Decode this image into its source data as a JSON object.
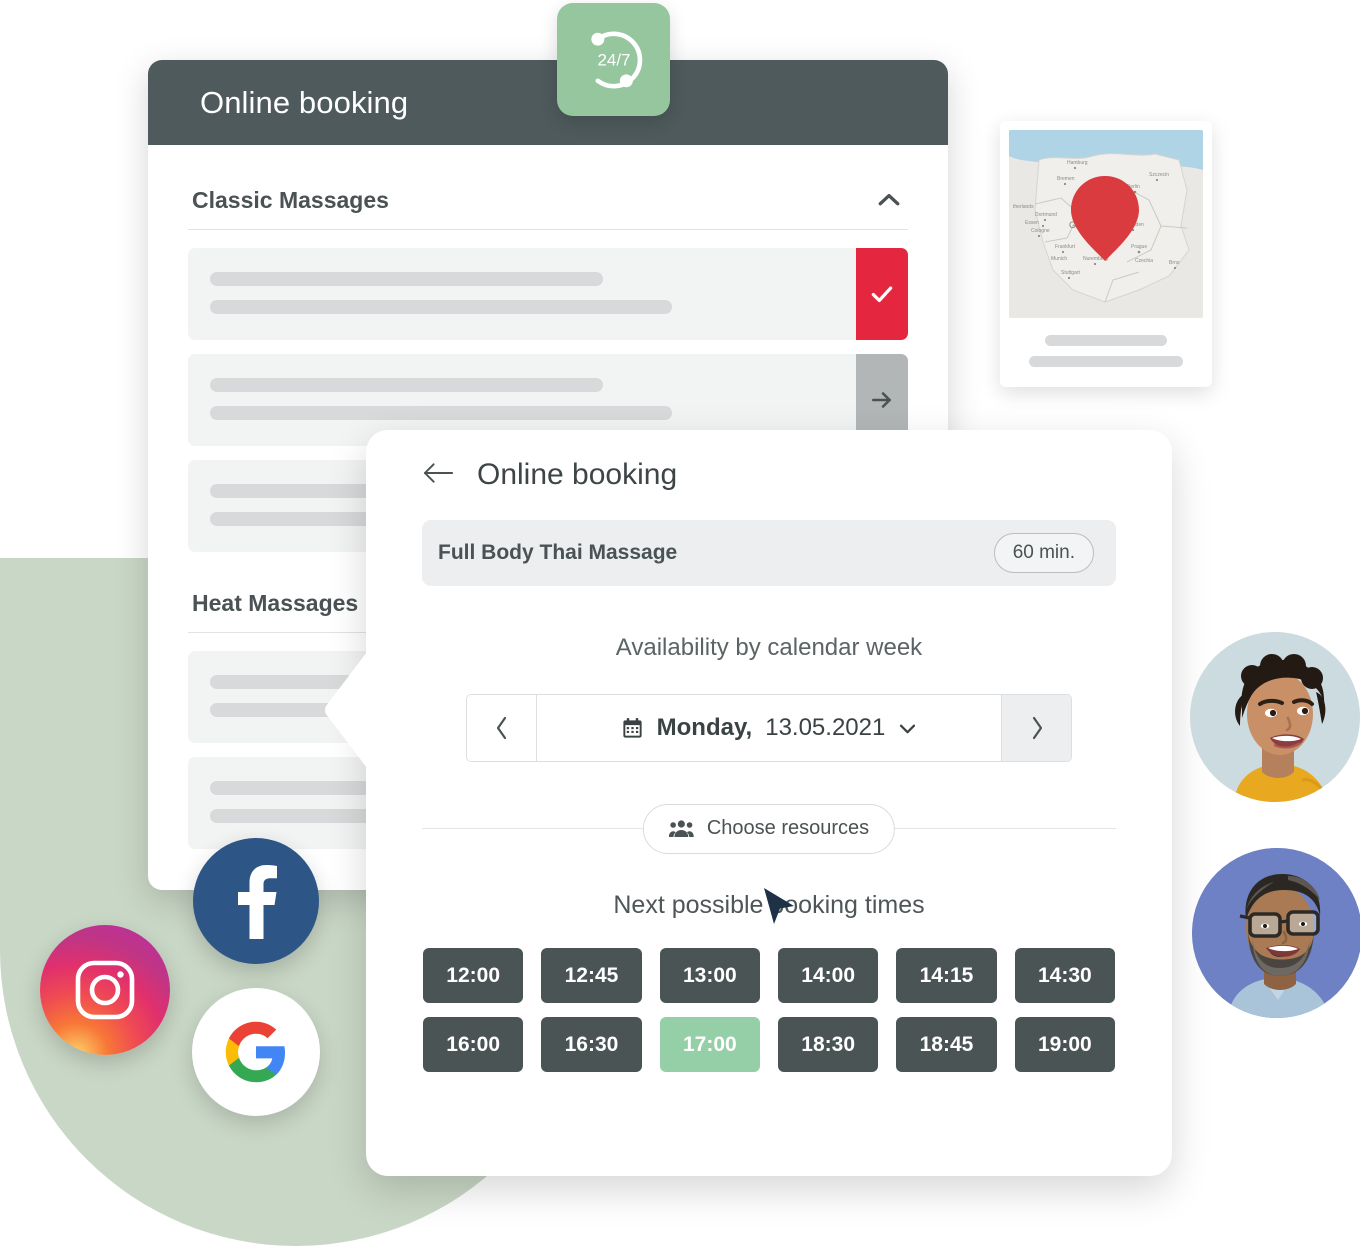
{
  "back_card": {
    "header_title": "Online booking",
    "badge": {
      "label": "24/7",
      "icon": "clock-cycle-icon",
      "color": "#95c69e"
    },
    "sections": [
      {
        "title": "Classic Massages",
        "expanded": true,
        "toggle_icon": "chevron-up-icon",
        "rows": [
          {
            "action": "check",
            "action_icon": "check-icon",
            "action_color": "#e4273f"
          },
          {
            "action": "next",
            "action_icon": "arrow-right-icon",
            "action_color": "#b3b6b7"
          },
          {
            "action": "none",
            "action_icon": "",
            "action_color": ""
          }
        ]
      },
      {
        "title": "Heat Massages",
        "expanded": true,
        "toggle_icon": "chevron-up-icon",
        "rows": [
          {
            "action": "none",
            "action_icon": "",
            "action_color": ""
          },
          {
            "action": "none",
            "action_icon": "",
            "action_color": ""
          }
        ]
      }
    ]
  },
  "map_card": {
    "pin_icon": "map-pin-icon",
    "pin_color": "#d93b3f",
    "country_label": "Germany",
    "labels": [
      "Hamburg",
      "Bremen",
      "Berlin",
      "Szczecin",
      "Netherlands",
      "Dortmund",
      "Essen",
      "Cologne",
      "Frankfurt",
      "Nuremberg",
      "Stuttgart",
      "Dresden",
      "Prague",
      "Czechia",
      "Munich",
      "Brno"
    ]
  },
  "dialog": {
    "back_icon": "arrow-left-icon",
    "title": "Online booking",
    "service": {
      "name": "Full Body Thai Massage",
      "duration": "60 min."
    },
    "availability_label": "Availability by calendar week",
    "date_picker": {
      "prev_icon": "chevron-left-icon",
      "next_icon": "chevron-right-icon",
      "calendar_icon": "calendar-icon",
      "dropdown_icon": "chevron-down-icon",
      "day": "Monday,",
      "date": "13.05.2021"
    },
    "resources": {
      "icon": "users-icon",
      "label": "Choose resources"
    },
    "cursor_icon": "mouse-cursor-icon",
    "slots_label": "Next possible booking times",
    "slots": [
      {
        "time": "12:00",
        "selected": false
      },
      {
        "time": "12:45",
        "selected": false
      },
      {
        "time": "13:00",
        "selected": false
      },
      {
        "time": "14:00",
        "selected": false
      },
      {
        "time": "14:15",
        "selected": false
      },
      {
        "time": "14:30",
        "selected": false
      },
      {
        "time": "16:00",
        "selected": false
      },
      {
        "time": "16:30",
        "selected": false
      },
      {
        "time": "17:00",
        "selected": true
      },
      {
        "time": "18:30",
        "selected": false
      },
      {
        "time": "18:45",
        "selected": false
      },
      {
        "time": "19:00",
        "selected": false
      }
    ],
    "slot_colors": {
      "default": "#4b5454",
      "selected": "#95cfa7"
    }
  },
  "social": [
    {
      "name": "facebook",
      "icon": "facebook-icon",
      "color": "#2d5585"
    },
    {
      "name": "instagram",
      "icon": "instagram-icon",
      "color": "#e1306c"
    },
    {
      "name": "google",
      "icon": "google-icon",
      "color": "#ffffff"
    }
  ],
  "avatars": [
    {
      "name": "avatar-woman",
      "bg": "#ccdbe0"
    },
    {
      "name": "avatar-man",
      "bg": "#6d81c4"
    }
  ],
  "theme": {
    "header_bg": "#4e5a5b",
    "blob": "#c9d7c6",
    "accent_green": "#95cfa7",
    "accent_red": "#e4273f"
  }
}
